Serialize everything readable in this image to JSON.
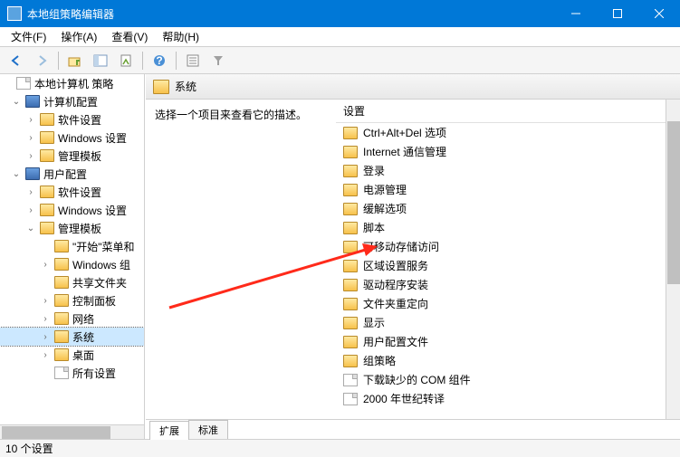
{
  "window": {
    "title": "本地组策略编辑器"
  },
  "menu": {
    "file": "文件(F)",
    "action": "操作(A)",
    "view": "查看(V)",
    "help": "帮助(H)"
  },
  "tree": {
    "root": "本地计算机 策略",
    "computer_config": "计算机配置",
    "cc_soft": "软件设置",
    "cc_windows": "Windows 设置",
    "cc_admin": "管理模板",
    "user_config": "用户配置",
    "uc_soft": "软件设置",
    "uc_windows": "Windows 设置",
    "uc_admin": "管理模板",
    "start_menu": "\"开始\"菜单和",
    "windows_comp": "Windows 组",
    "shared_folders": "共享文件夹",
    "control_panel": "控制面板",
    "network": "网络",
    "system": "系统",
    "desktop": "桌面",
    "all_settings": "所有设置"
  },
  "content": {
    "header": "系统",
    "description": "选择一个项目来查看它的描述。",
    "column_header": "设置",
    "items": [
      {
        "label": "Ctrl+Alt+Del 选项",
        "kind": "folder"
      },
      {
        "label": "Internet 通信管理",
        "kind": "folder"
      },
      {
        "label": "登录",
        "kind": "folder"
      },
      {
        "label": "电源管理",
        "kind": "folder"
      },
      {
        "label": "缓解选项",
        "kind": "folder"
      },
      {
        "label": "脚本",
        "kind": "folder"
      },
      {
        "label": "可移动存储访问",
        "kind": "folder"
      },
      {
        "label": "区域设置服务",
        "kind": "folder"
      },
      {
        "label": "驱动程序安装",
        "kind": "folder"
      },
      {
        "label": "文件夹重定向",
        "kind": "folder"
      },
      {
        "label": "显示",
        "kind": "folder"
      },
      {
        "label": "用户配置文件",
        "kind": "folder"
      },
      {
        "label": "组策略",
        "kind": "folder"
      },
      {
        "label": "下载缺少的 COM 组件",
        "kind": "page"
      },
      {
        "label": "2000 年世纪转译",
        "kind": "page"
      }
    ]
  },
  "tabs": {
    "extended": "扩展",
    "standard": "标准"
  },
  "status": "10 个设置"
}
